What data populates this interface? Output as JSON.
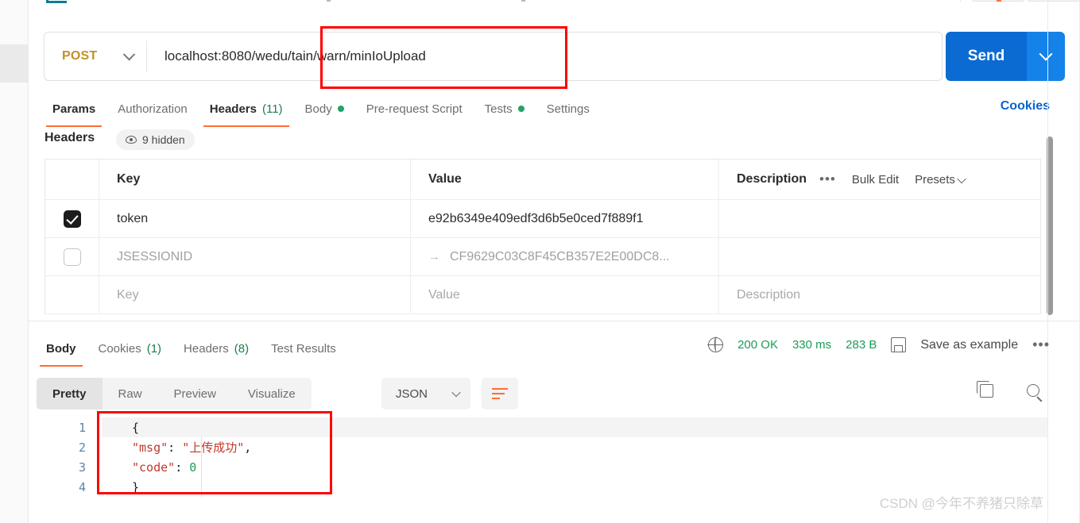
{
  "request": {
    "method": "POST",
    "url": "localhost:8080/wedu/tain/warn/minIoUpload",
    "send_label": "Send",
    "cookies_link": "Cookies",
    "tabs": [
      {
        "label": "Params",
        "count": "",
        "dot": false,
        "active": false
      },
      {
        "label": "Authorization",
        "count": "",
        "dot": false,
        "active": false
      },
      {
        "label": "Headers",
        "count": "(11)",
        "dot": false,
        "active": true
      },
      {
        "label": "Body",
        "count": "",
        "dot": true,
        "active": false
      },
      {
        "label": "Pre-request Script",
        "count": "",
        "dot": false,
        "active": false
      },
      {
        "label": "Tests",
        "count": "",
        "dot": true,
        "active": false
      },
      {
        "label": "Settings",
        "count": "",
        "dot": false,
        "active": false
      }
    ]
  },
  "headers_pane": {
    "section_label": "Headers",
    "hidden_badge": "9 hidden",
    "columns": {
      "key": "Key",
      "value": "Value",
      "description": "Description"
    },
    "tools": {
      "more": "•••",
      "bulk_edit": "Bulk Edit",
      "presets": "Presets"
    },
    "rows": [
      {
        "checked": true,
        "placeholder": false,
        "key": "token",
        "value": "e92b6349e409edf3d6b5e0ced7f889f1",
        "description": "",
        "inherited": false
      },
      {
        "checked": false,
        "placeholder": false,
        "key": "JSESSIONID",
        "value": "CF9629C03C8F45CB357E2E00DC8...",
        "description": "",
        "inherited": true
      },
      {
        "checked": null,
        "placeholder": true,
        "key": "Key",
        "value": "Value",
        "description": "Description",
        "inherited": false
      }
    ]
  },
  "response": {
    "tabs": [
      {
        "label": "Body",
        "count": "",
        "active": true
      },
      {
        "label": "Cookies",
        "count": "(1)",
        "active": false
      },
      {
        "label": "Headers",
        "count": "(8)",
        "active": false
      },
      {
        "label": "Test Results",
        "count": "",
        "active": false
      }
    ],
    "status": "200 OK",
    "time": "330 ms",
    "size": "283 B",
    "save_as_example": "Save as example",
    "more": "•••",
    "format_tabs": [
      {
        "label": "Pretty",
        "active": true
      },
      {
        "label": "Raw",
        "active": false
      },
      {
        "label": "Preview",
        "active": false
      },
      {
        "label": "Visualize",
        "active": false
      }
    ],
    "language": "JSON",
    "body_lines": [
      {
        "n": "1",
        "segments": [
          {
            "t": "{",
            "c": "tok-brace"
          }
        ]
      },
      {
        "n": "2",
        "segments": [
          {
            "t": "\"msg\"",
            "c": "tok-key"
          },
          {
            "t": ": ",
            "c": "tok-punc"
          },
          {
            "t": "\"上传成功\"",
            "c": "tok-str"
          },
          {
            "t": ",",
            "c": "tok-punc"
          }
        ]
      },
      {
        "n": "3",
        "segments": [
          {
            "t": "\"code\"",
            "c": "tok-key"
          },
          {
            "t": ": ",
            "c": "tok-punc"
          },
          {
            "t": "0",
            "c": "tok-num"
          }
        ]
      },
      {
        "n": "4",
        "segments": [
          {
            "t": "}",
            "c": "tok-brace"
          }
        ]
      }
    ]
  },
  "watermark": "CSDN @今年不养猪只除草",
  "colors": {
    "accent_orange": "#ff6c37",
    "send_blue": "#0b6bd3",
    "link_blue": "#0a63ce",
    "status_green": "#1a9c55",
    "method_gold": "#c2912a",
    "annotation_red": "#ff0000"
  }
}
